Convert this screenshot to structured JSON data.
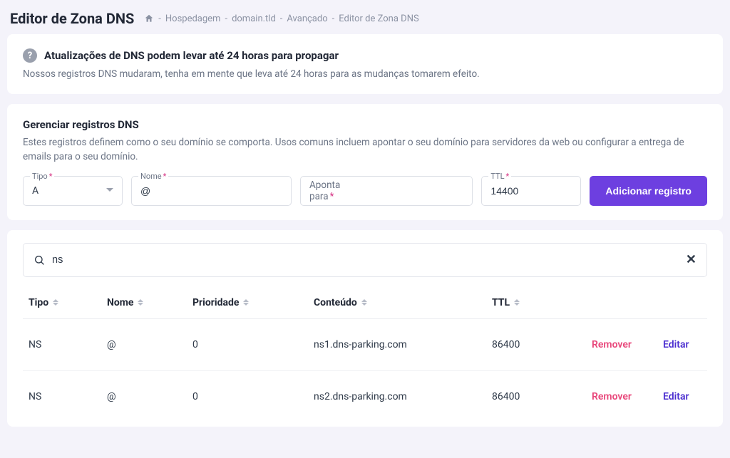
{
  "page": {
    "title": "Editor de Zona DNS"
  },
  "breadcrumb": {
    "items": [
      "Hospedagem",
      "domain.tld",
      "Avançado",
      "Editor de Zona DNS"
    ]
  },
  "info": {
    "title": "Atualizações de DNS podem levar até 24 horas para propagar",
    "body": "Nossos registros DNS mudaram, tenha em mente que leva até 24 horas para as mudanças tomarem efeito."
  },
  "manage": {
    "title": "Gerenciar registros DNS",
    "desc": "Estes registros definem como o seu domínio se comporta. Usos comuns incluem apontar o seu domínio para servidores da web ou configurar a entrega de emails para o seu domínio.",
    "fields": {
      "type_label": "Tipo",
      "type_value": "A",
      "name_label": "Nome",
      "name_value": "@",
      "points_label": "Aponta para",
      "points_value": "",
      "ttl_label": "TTL",
      "ttl_value": "14400"
    },
    "add_button": "Adicionar registro"
  },
  "search": {
    "value": "ns"
  },
  "table": {
    "headers": {
      "tipo": "Tipo",
      "nome": "Nome",
      "prioridade": "Prioridade",
      "conteudo": "Conteúdo",
      "ttl": "TTL"
    },
    "actions": {
      "remove": "Remover",
      "edit": "Editar"
    },
    "rows": [
      {
        "tipo": "NS",
        "nome": "@",
        "prioridade": "0",
        "conteudo": "ns1.dns-parking.com",
        "ttl": "86400"
      },
      {
        "tipo": "NS",
        "nome": "@",
        "prioridade": "0",
        "conteudo": "ns2.dns-parking.com",
        "ttl": "86400"
      }
    ]
  }
}
